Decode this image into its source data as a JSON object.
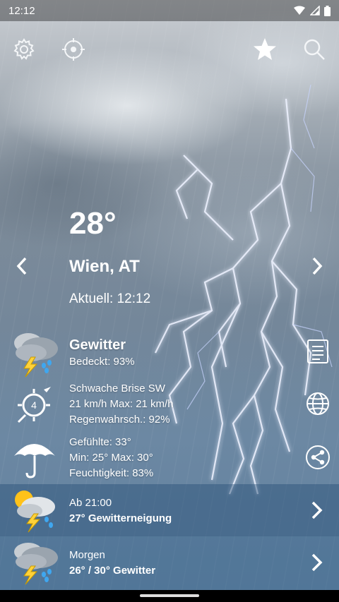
{
  "status_bar": {
    "time": "12:12"
  },
  "toolbar": {
    "settings_icon": "gear-icon",
    "location_icon": "crosshair-icon",
    "favorite_icon": "star-icon",
    "search_icon": "search-icon"
  },
  "current": {
    "temperature": "28°",
    "city": "Wien, AT",
    "updated": "Aktuell: 12:12"
  },
  "conditions": {
    "title": "Gewitter",
    "cloud_cover": "Bedeckt: 93%"
  },
  "wind": {
    "description": "Schwache Brise SW",
    "speed": "21 km/h Max: 21 km/h",
    "rain_chance": "Regenwahrsch.: 92%",
    "beaufort": "4"
  },
  "feels": {
    "feels_like": "Gefühlte: 33°",
    "min_max": "Min: 25° Max: 30°",
    "humidity": "Feuchtigkeit: 83%"
  },
  "forecast": [
    {
      "label": "Ab 21:00",
      "summary": "27° Gewitterneigung"
    },
    {
      "label": "Morgen",
      "summary": "26° / 30° Gewitter"
    }
  ],
  "side_actions": [
    "report-icon",
    "globe-icon",
    "share-icon"
  ],
  "colors": {
    "text": "#ffffff",
    "forecast_band": "#2d5a85"
  }
}
